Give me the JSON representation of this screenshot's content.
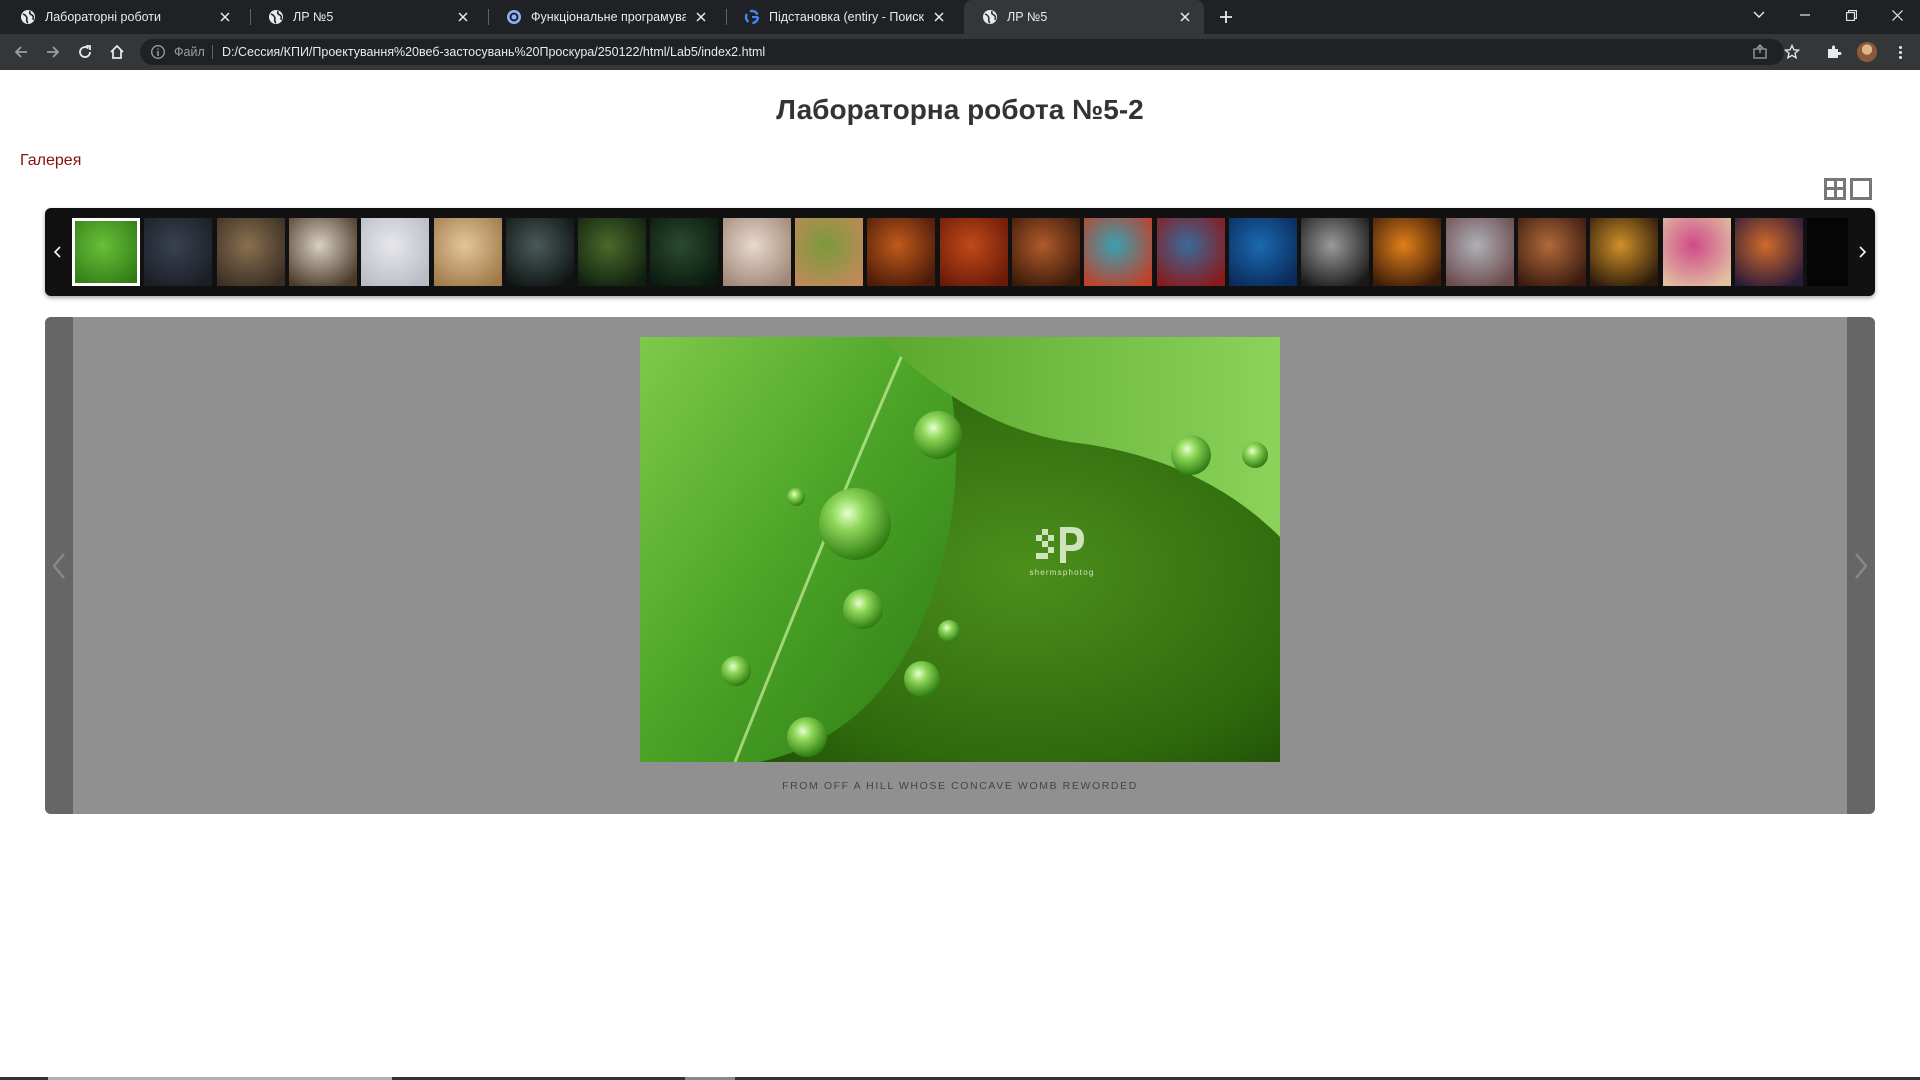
{
  "browser": {
    "tabs": [
      {
        "title": "Лабораторні роботи",
        "icon": "globe-icon",
        "active": false
      },
      {
        "title": "ЛР №5",
        "icon": "globe-icon",
        "active": false
      },
      {
        "title": "Функціональне програмування",
        "icon": "app-icon",
        "active": false
      },
      {
        "title": "Підстановка (entiry - Поиск в Google",
        "icon": "google-icon",
        "active": false
      },
      {
        "title": "ЛР №5",
        "icon": "globe-icon",
        "active": true
      }
    ],
    "address": {
      "scheme_label": "Файл",
      "url": "D:/Сессия/КПИ/Проектування%20веб-застосувань%20Проскура/250122/html/Lab5/index2.html"
    },
    "colors": {
      "tabstrip": "#202124",
      "toolbar": "#35363a",
      "text": "#e8eaed"
    }
  },
  "page": {
    "title": "Лабораторна робота №5-2",
    "gallery_link": "Галерея"
  },
  "gallery": {
    "thumbnail_count": 24,
    "current_index": 0,
    "caption": "FROM OFF A HILL WHOSE CONCAVE WOMB REWORDED",
    "watermark": "shermsphotog",
    "colors": {
      "strip": "#111111",
      "viewer": "#909090",
      "viewer_side": "#666666",
      "link": "#8a1010"
    }
  }
}
